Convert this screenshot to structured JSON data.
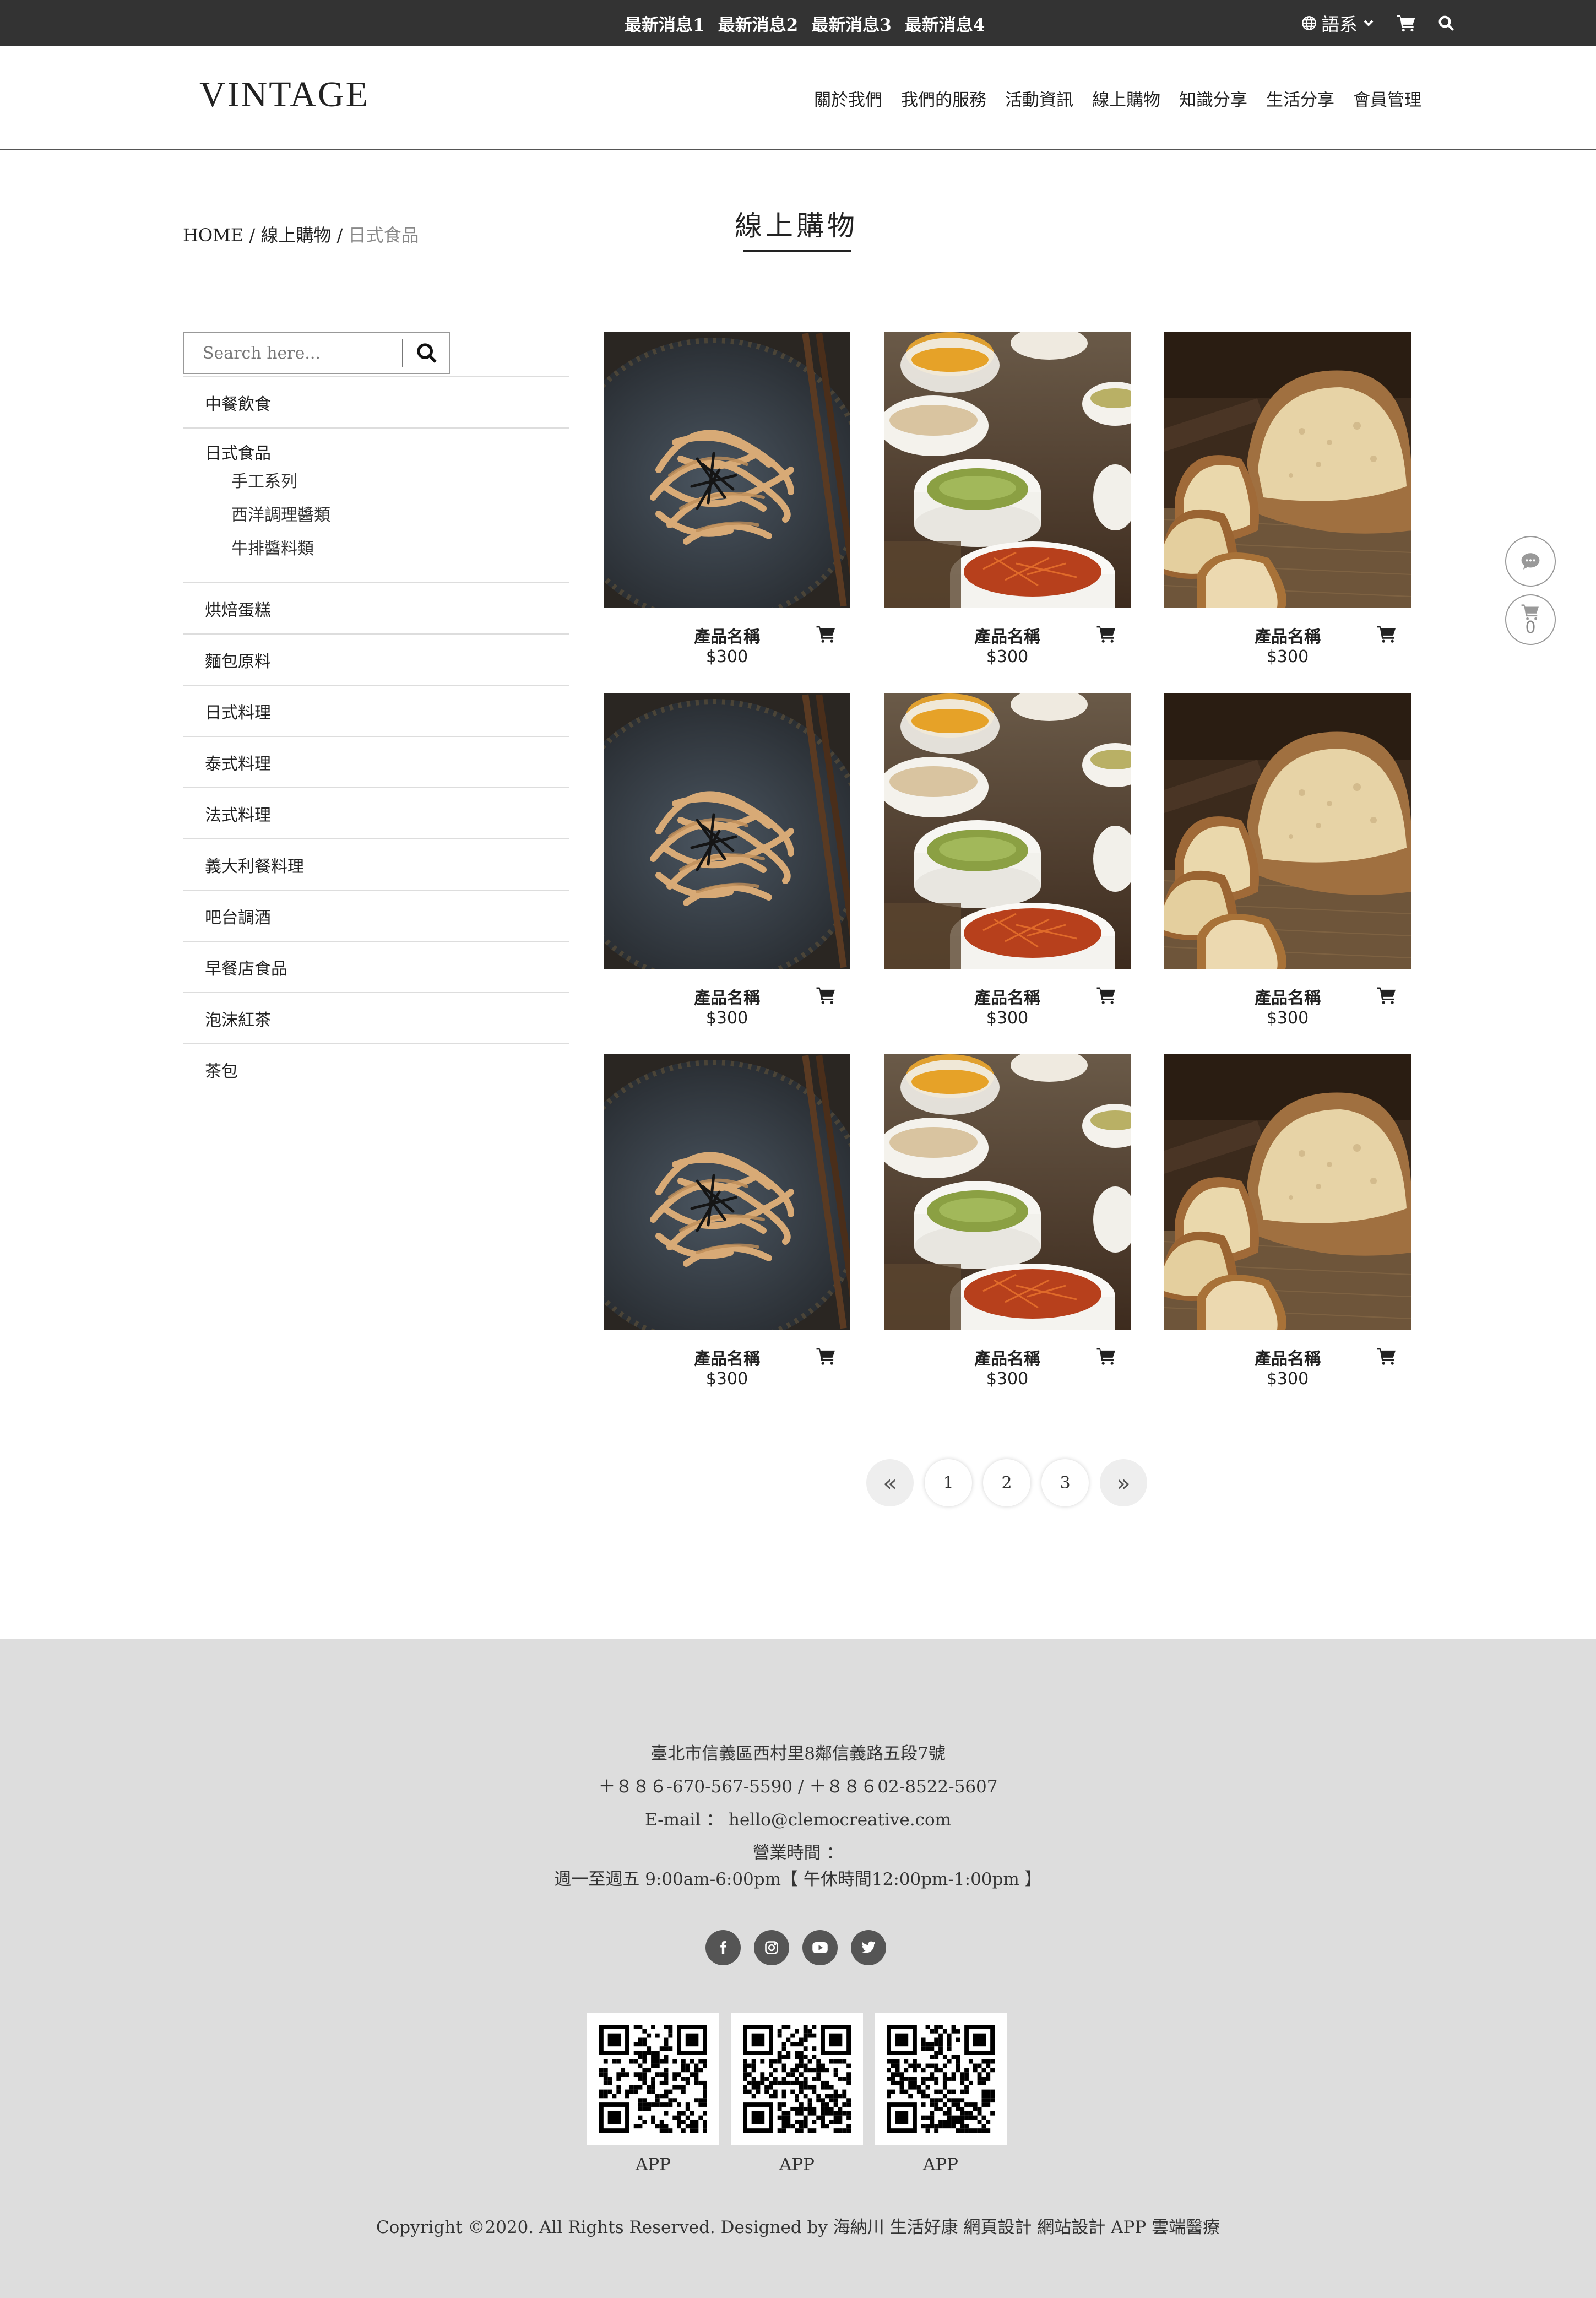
{
  "topbar": {
    "news": [
      "最新消息1",
      "最新消息2",
      "最新消息3",
      "最新消息4"
    ],
    "language_label": "語系",
    "icons": [
      "globe-icon",
      "chevron-down-icon",
      "cart-icon",
      "search-icon"
    ]
  },
  "header": {
    "logo": "VINTAGE",
    "nav": [
      "關於我們",
      "我們的服務",
      "活動資訊",
      "線上購物",
      "知識分享",
      "生活分享",
      "會員管理"
    ]
  },
  "breadcrumb": {
    "home": "HOME",
    "sep1": " / ",
    "section": "線上購物",
    "sep2": " / ",
    "current": "日式食品"
  },
  "page_title": "線上購物",
  "sidebar": {
    "search_placeholder": "Search here...",
    "categories": [
      "中餐飲食",
      "日式食品",
      "烘焙蛋糕",
      "麵包原料",
      "日式料理",
      "泰式料理",
      "法式料理",
      "義大利餐料理",
      "吧台調酒",
      "早餐店食品",
      "泡沫紅茶",
      "茶包"
    ],
    "subcategories": [
      "手工系列",
      "西洋調理醬類",
      "牛排醬料類"
    ]
  },
  "products": [
    {
      "name": "產品名稱",
      "price": "$300",
      "image": "noodles"
    },
    {
      "name": "產品名稱",
      "price": "$300",
      "image": "spices"
    },
    {
      "name": "產品名稱",
      "price": "$300",
      "image": "bread"
    },
    {
      "name": "產品名稱",
      "price": "$300",
      "image": "noodles"
    },
    {
      "name": "產品名稱",
      "price": "$300",
      "image": "spices"
    },
    {
      "name": "產品名稱",
      "price": "$300",
      "image": "bread"
    },
    {
      "name": "產品名稱",
      "price": "$300",
      "image": "noodles"
    },
    {
      "name": "產品名稱",
      "price": "$300",
      "image": "spices"
    },
    {
      "name": "產品名稱",
      "price": "$300",
      "image": "bread"
    }
  ],
  "pagination": {
    "prev": "«",
    "pages": [
      "1",
      "2",
      "3"
    ],
    "next": "»"
  },
  "floating": {
    "chat_icon": "chat-icon",
    "cart_count": "0"
  },
  "footer": {
    "address": "臺北市信義區西村里8鄰信義路五段7號",
    "phone": "＋８８６-670-567-5590 / ＋８８６02-8522-5607",
    "email": "E-mail ： hello@clemocreative.com",
    "hours_label": "營業時間 ：",
    "hours": "週一至週五 9:00am-6:00pm【 午休時間12:00pm-1:00pm 】",
    "social": [
      "facebook-icon",
      "instagram-icon",
      "youtube-icon",
      "twitter-icon"
    ],
    "qr_labels": [
      "APP",
      "APP",
      "APP"
    ],
    "copyright": "Copyright ©2020. All Rights Reserved. Designed by 海納川 生活好康 網頁設計 網站設計 APP 雲端醫療"
  },
  "colors": {
    "topbar_bg": "#333333",
    "footer_bg": "#dddddd",
    "social_bg": "#555555",
    "text": "#222222"
  }
}
